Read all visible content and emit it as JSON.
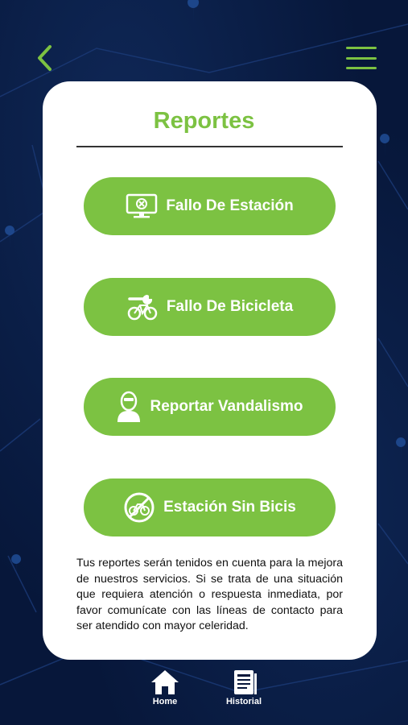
{
  "header": {
    "back_icon": "chevron-left-icon",
    "menu_icon": "hamburger-menu-icon",
    "accent_color": "#7cc242"
  },
  "card": {
    "title": "Reportes",
    "buttons": [
      {
        "label": "Fallo De Estación",
        "icon": "monitor-error-icon"
      },
      {
        "label": "Fallo De Bicicleta",
        "icon": "bicycle-wrench-icon"
      },
      {
        "label": "Reportar Vandalismo",
        "icon": "masked-person-icon"
      },
      {
        "label": "Estación Sin Bicis",
        "icon": "no-bicycle-icon"
      }
    ],
    "info_text": "Tus reportes serán tenidos en cuenta para la mejora de nuestros servicios. Si se trata de una situación que requiera atención o respuesta inmediata, por favor comunícate con las líneas de contacto para ser atendido con mayor celeridad."
  },
  "bottom_nav": {
    "items": [
      {
        "label": "Home",
        "icon": "home-icon"
      },
      {
        "label": "Historial",
        "icon": "history-document-icon"
      }
    ]
  },
  "colors": {
    "background": "#07173a",
    "button": "#7cc242",
    "card": "#ffffff"
  }
}
